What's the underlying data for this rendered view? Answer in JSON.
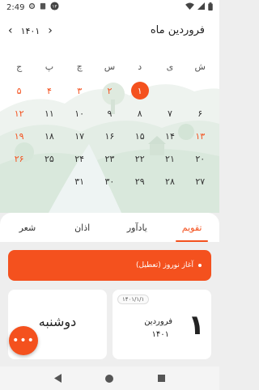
{
  "status_bar": {
    "time": "2:49",
    "icons": [
      "settings-icon",
      "clipboard-icon",
      "notification-badge-icon"
    ],
    "badge": "۱۲",
    "right_icons": [
      "wifi-icon",
      "signal-icon",
      "battery-icon"
    ]
  },
  "calendar": {
    "month_title": "فروردین ماه",
    "year": "۱۴۰۱",
    "weekday_headers": [
      "ج",
      "پ",
      "چ",
      "س",
      "د",
      "ی",
      "ش"
    ],
    "rows": [
      [
        {
          "d": "۵",
          "h": true
        },
        {
          "d": "۴",
          "h": true
        },
        {
          "d": "۳",
          "h": true
        },
        {
          "d": "۲",
          "h": true
        },
        {
          "d": "۱",
          "today": true
        },
        {
          "d": ""
        },
        {
          "d": ""
        }
      ],
      [
        {
          "d": "۱۲",
          "h": true
        },
        {
          "d": "۱۱"
        },
        {
          "d": "۱۰"
        },
        {
          "d": "۹"
        },
        {
          "d": "۸"
        },
        {
          "d": "۷"
        },
        {
          "d": "۶"
        }
      ],
      [
        {
          "d": "۱۹",
          "h": true
        },
        {
          "d": "۱۸"
        },
        {
          "d": "۱۷"
        },
        {
          "d": "۱۶"
        },
        {
          "d": "۱۵"
        },
        {
          "d": "۱۴"
        },
        {
          "d": "۱۳",
          "h": true
        }
      ],
      [
        {
          "d": "۲۶",
          "h": true
        },
        {
          "d": "۲۵"
        },
        {
          "d": "۲۴"
        },
        {
          "d": "۲۳"
        },
        {
          "d": "۲۲"
        },
        {
          "d": "۲۱"
        },
        {
          "d": "۲۰"
        }
      ],
      [
        {
          "d": ""
        },
        {
          "d": ""
        },
        {
          "d": "۳۱"
        },
        {
          "d": "۳۰"
        },
        {
          "d": "۲۹"
        },
        {
          "d": "۲۸"
        },
        {
          "d": "۲۷"
        }
      ]
    ]
  },
  "tabs": [
    {
      "label": "شعر",
      "active": false
    },
    {
      "label": "اذان",
      "active": false
    },
    {
      "label": "یادآور",
      "active": false
    },
    {
      "label": "تقویم",
      "active": true
    }
  ],
  "event": {
    "text": "آغاز نوروز (تعطیل)"
  },
  "day_card": {
    "date_chip": "۱۴۰۱/۱/۱",
    "big_day": "۱",
    "month": "فروردین",
    "year": "۱۴۰۱"
  },
  "weekday_card": {
    "weekday": "دوشنبه"
  },
  "fab": {
    "label": "•••"
  },
  "colors": {
    "accent": "#f4511e",
    "background": "#eeeeee"
  }
}
